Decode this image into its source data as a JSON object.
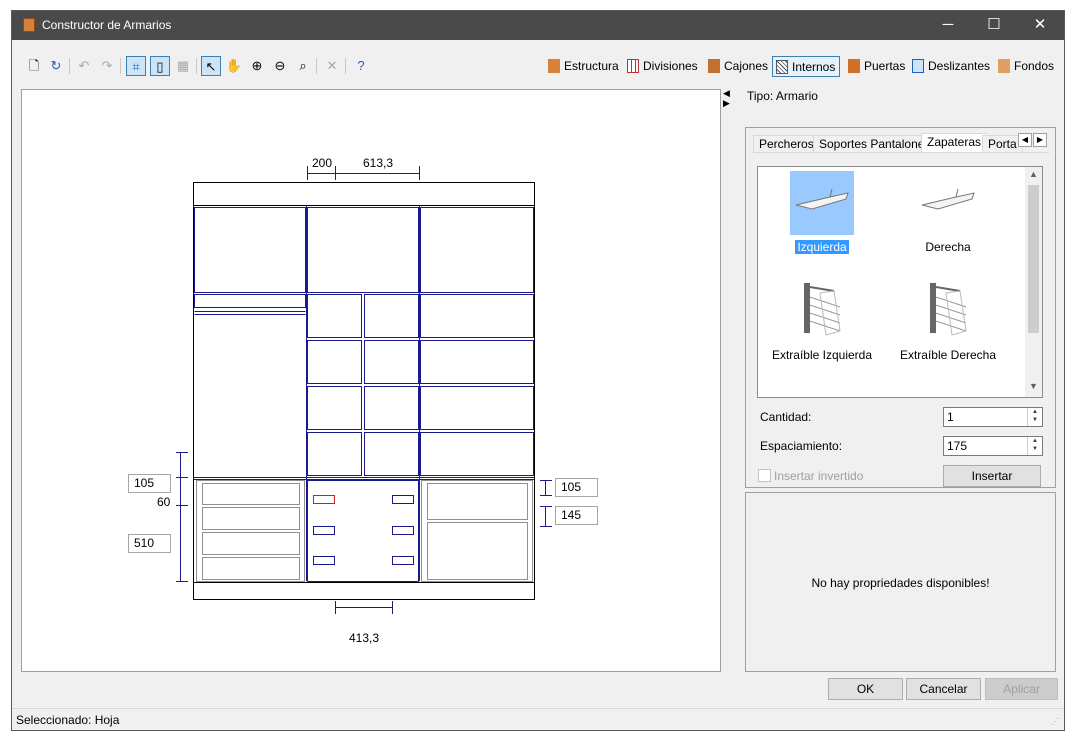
{
  "window": {
    "title": "Constructor de Armarios",
    "icon": "wardrobe-app-icon",
    "min": "─",
    "max": "☐",
    "close": "✕"
  },
  "toolbar": {
    "icons": [
      "new-doc-icon",
      "refresh-icon",
      "undo-icon",
      "redo-icon",
      "auto-dimension-icon",
      "fit-icon",
      "grid-icon",
      "pointer-icon",
      "pan-icon",
      "zoom-in-icon",
      "zoom-out-icon",
      "zoom-fit-icon",
      "delete-icon",
      "help-icon"
    ],
    "tabs": {
      "estructura": "Estructura",
      "divisiones": "Divisiones",
      "cajones": "Cajones",
      "internos": "Internos",
      "puertas": "Puertas",
      "deslizantes": "Deslizantes",
      "fondos": "Fondos"
    }
  },
  "drawing": {
    "top_dims": [
      "200",
      "613,3"
    ],
    "bottom_dim": "413,3",
    "left_boxes": [
      "105",
      "510"
    ],
    "left_text": "60",
    "right_boxes": [
      "105",
      "145"
    ]
  },
  "right": {
    "tipo": "Tipo: Armario",
    "tabs": {
      "percheros": "Percheros",
      "soportes": "Soportes Pantalones",
      "zapateras": "Zapateras",
      "porta": "Porta"
    },
    "items": {
      "izquierda": "Izquierda",
      "derecha": "Derecha",
      "extr_izq": "Extraíble Izquierda",
      "extr_der": "Extraíble Derecha"
    },
    "cantidad_label": "Cantidad:",
    "cantidad_value": "1",
    "espaciamiento_label": "Espaciamiento:",
    "espaciamiento_value": "175",
    "invertido_label": "Insertar invertido",
    "insertar": "Insertar",
    "no_props": "No hay propriedades disponibles!"
  },
  "buttons": {
    "ok": "OK",
    "cancelar": "Cancelar",
    "aplicar": "Aplicar"
  },
  "status": "Seleccionado: Hoja",
  "colors": {
    "titlebar": "#4a4a4a",
    "dimension": "#1a1a8c",
    "selection": "#3399ff",
    "highlight_red": "#cc2020"
  }
}
